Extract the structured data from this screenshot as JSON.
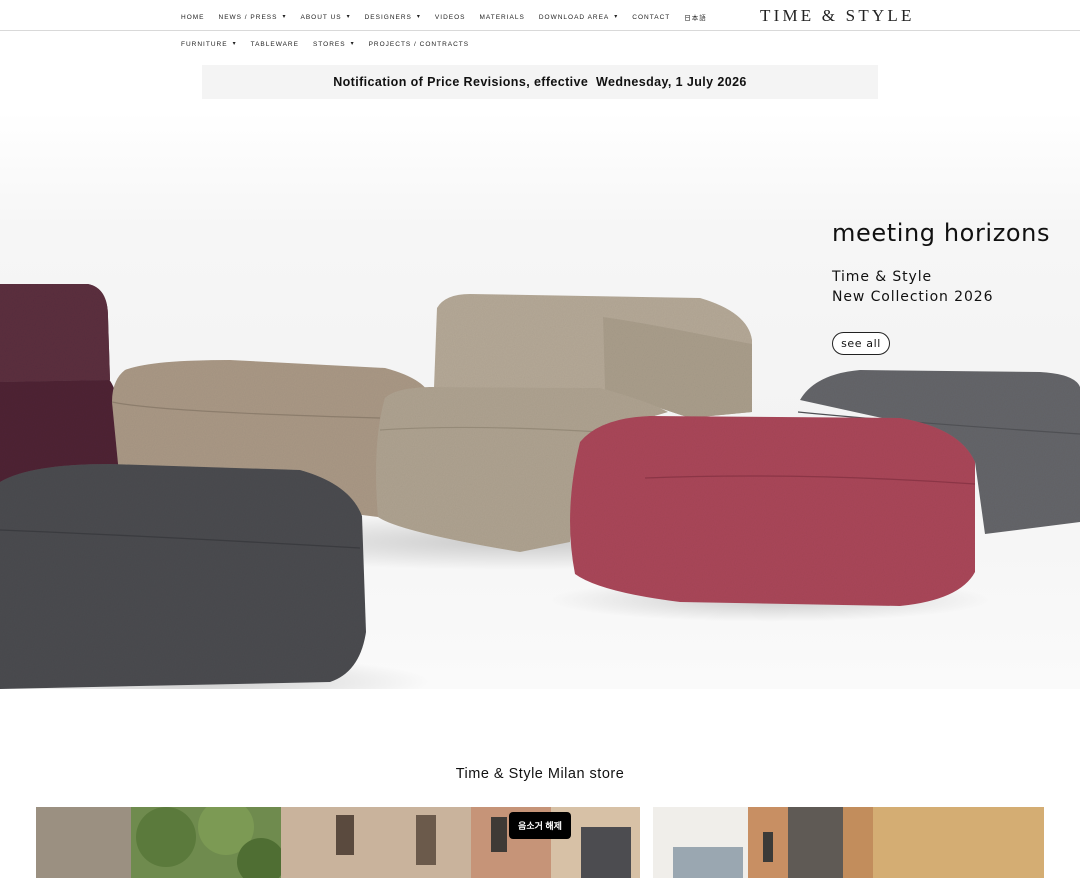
{
  "header": {
    "logo": "TIME & STYLE",
    "nav_primary": [
      {
        "label": "HOME",
        "dropdown": false
      },
      {
        "label": "NEWS / PRESS",
        "dropdown": true
      },
      {
        "label": "ABOUT US",
        "dropdown": true
      },
      {
        "label": "DESIGNERS",
        "dropdown": true
      },
      {
        "label": "VIDEOS",
        "dropdown": false
      },
      {
        "label": "MATERIALS",
        "dropdown": false
      },
      {
        "label": "DOWNLOAD AREA",
        "dropdown": true
      },
      {
        "label": "CONTACT",
        "dropdown": false
      },
      {
        "label": "日本語",
        "dropdown": false
      }
    ],
    "nav_secondary": [
      {
        "label": "FURNITURE",
        "dropdown": true
      },
      {
        "label": "TABLEWARE",
        "dropdown": false
      },
      {
        "label": "STORES",
        "dropdown": true
      },
      {
        "label": "PROJECTS / CONTRACTS",
        "dropdown": false
      }
    ]
  },
  "notice": {
    "text": "Notification of Price Revisions, effective  Wednesday, 1 July 2026"
  },
  "hero": {
    "title": "meeting horizons",
    "line1": "Time & Style",
    "line2": "New Collection 2026",
    "button": "see all"
  },
  "store": {
    "title": "Time & Style Milan store",
    "badge": "음소거 해제"
  },
  "colors": {
    "plum": "#5a2c3e",
    "sand": "#a89a88",
    "stone": "#b3a797",
    "charcoal": "#4a4b4f",
    "raspberry": "#a8475a",
    "slate": "#636468"
  }
}
